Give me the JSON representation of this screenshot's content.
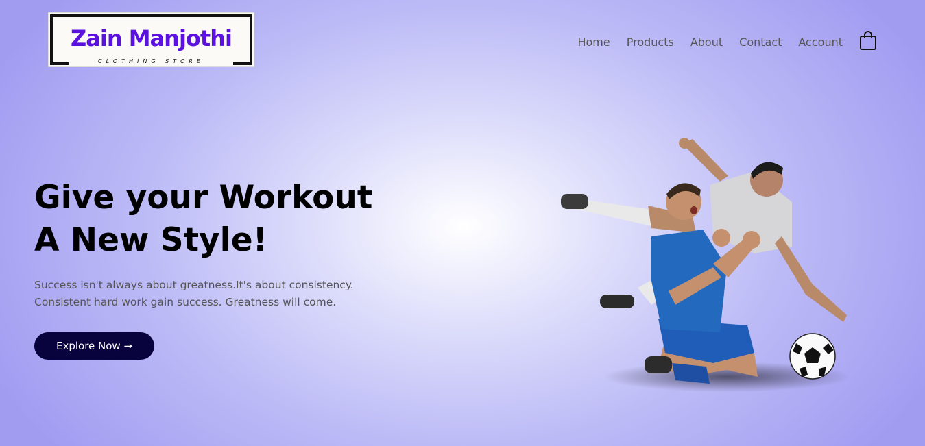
{
  "logo": {
    "brand": "Zain Manjothi",
    "tagline": "CLOTHING STORE"
  },
  "nav": {
    "items": [
      "Home",
      "Products",
      "About",
      "Contact",
      "Account"
    ],
    "cart_icon": "shopping-bag-icon"
  },
  "hero": {
    "title_line1": "Give your Workout",
    "title_line2": "A New Style!",
    "subtitle_line1": "Success isn't always about greatness.It's about consistency.",
    "subtitle_line2": "Consistent hard work gain success. Greatness will come.",
    "cta_label": "Explore Now →"
  },
  "colors": {
    "brand_purple": "#5b12e0",
    "button_bg": "#09033d",
    "nav_text": "#555555"
  }
}
